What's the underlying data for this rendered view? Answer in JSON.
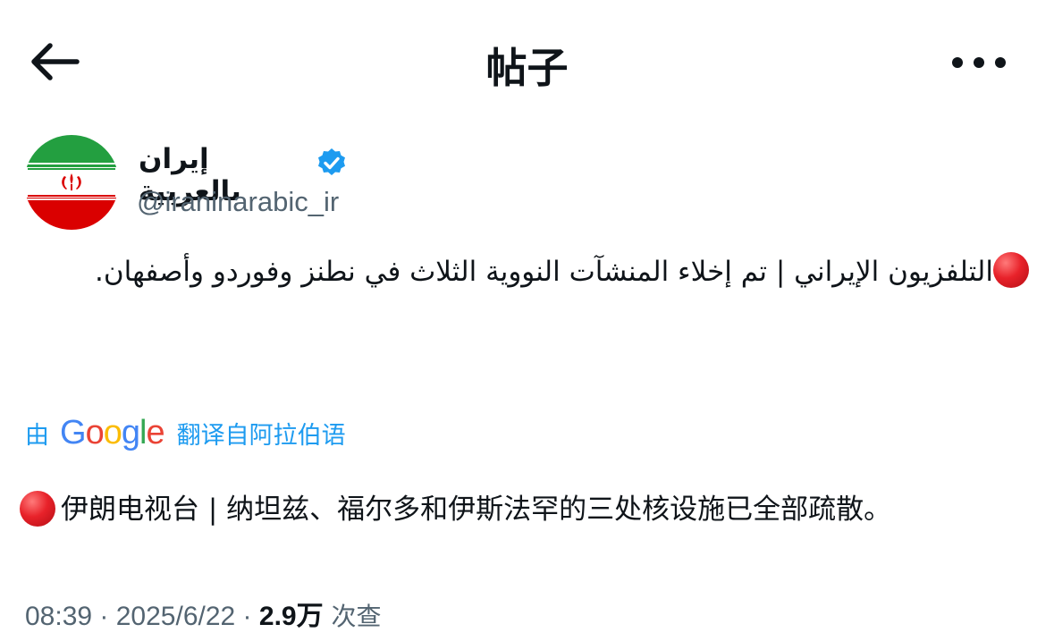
{
  "header": {
    "title": "帖子",
    "back_icon": "arrow-left-icon",
    "more_icon": "more-horizontal-icon"
  },
  "author": {
    "name": "إيران بالعربية",
    "handle": "@iraninarabic_ir",
    "verified": true,
    "avatar": "iran-flag"
  },
  "post": {
    "text": "التلفزيون الإيراني | تم إخلاء المنشآت النووية الثلاث في نطنز وفوردو وأصفهان.",
    "leading_icon": "red-circle-emoji"
  },
  "translation": {
    "by": "由",
    "provider": "Google",
    "from": "翻译自阿拉伯语",
    "text": "伊朗电视台 | 纳坦兹、福尔多和伊斯法罕的三处核设施已全部疏散。"
  },
  "meta": {
    "time": "08:39",
    "sep1": " · ",
    "date": "2025/6/22",
    "sep2": " · ",
    "views": "2.9万",
    "views_label": " 次查"
  },
  "colors": {
    "accent": "#1d9bf0",
    "text": "#0f1419",
    "muted": "#536471",
    "verified": "#1d9bf0"
  }
}
